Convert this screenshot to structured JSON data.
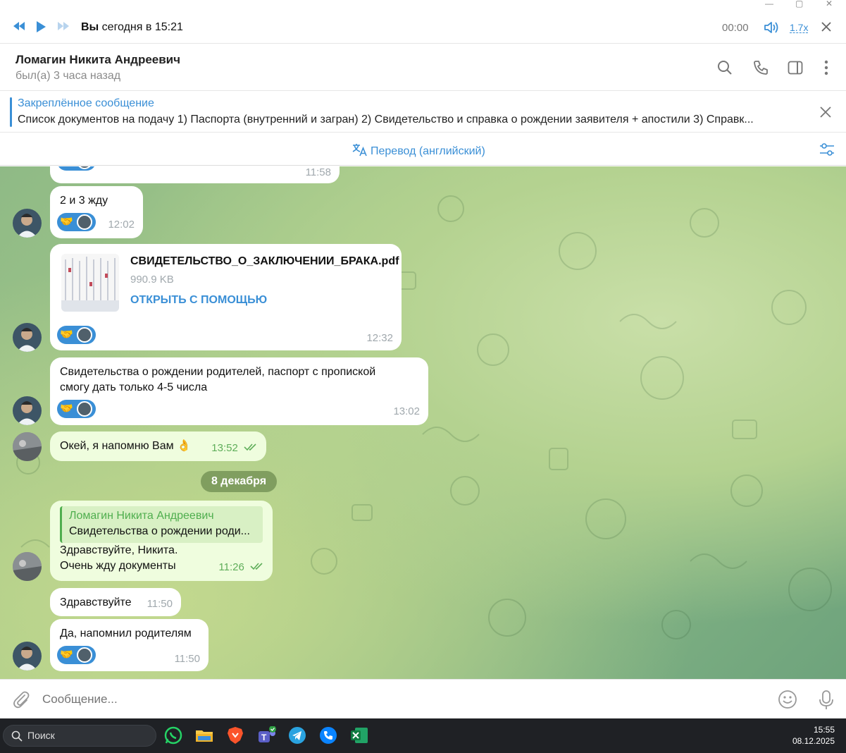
{
  "player": {
    "title_bold": "Вы",
    "title_rest": " сегодня в 15:21",
    "time": "00:00",
    "speed": "1.7x"
  },
  "chat_header": {
    "name": "Ломагин Никита Андреевич",
    "status": "был(а) 3 часа назад"
  },
  "pinned": {
    "title": "Закреплённое сообщение",
    "text": "Список документов на подачу   1) Паспорта (внутренний и загран) 2) Свидетельство и справка о рождении заявителя + апостили 3) Справк..."
  },
  "translate": {
    "label": "Перевод (английский)"
  },
  "messages": {
    "m0": {
      "time": "11:58"
    },
    "m1": {
      "text": "2 и 3 жду",
      "time": "12:02",
      "reaction": "🤝"
    },
    "m2": {
      "file_name": "СВИДЕТЕЛЬСТВО_О_ЗАКЛЮЧЕНИИ_БРАКА.pdf",
      "file_size": "990.9 KB",
      "open_label": "ОТКРЫТЬ С ПОМОЩЬЮ",
      "time": "12:32",
      "reaction": "🤝"
    },
    "m3": {
      "line1": "Свидетельства о рождении родителей, паспорт с пропиской",
      "line2": "смогу дать только 4-5 числа",
      "time": "13:02",
      "reaction": "🤝"
    },
    "m4": {
      "text": "Окей, я напомню Вам 👌",
      "time": "13:52"
    },
    "date": "8 декабря",
    "m5": {
      "reply_name": "Ломагин Никита Андреевич",
      "reply_text": "Свидетельства о рождении роди...",
      "line1": "Здравствуйте, Никита.",
      "line2": "Очень жду документы",
      "time": "11:26"
    },
    "m6": {
      "text": "Здравствуйте",
      "time": "11:50"
    },
    "m7": {
      "text": "Да, напомнил родителям",
      "time": "11:50",
      "reaction": "🤝"
    }
  },
  "composer": {
    "placeholder": "Сообщение..."
  },
  "taskbar": {
    "search_label": "Поиск",
    "time": "15:55",
    "date": "08.12.2025"
  }
}
